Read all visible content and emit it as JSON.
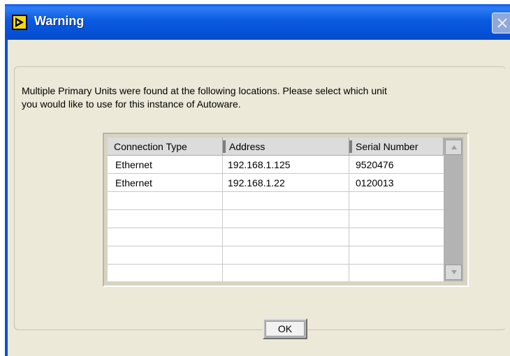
{
  "window": {
    "title": "Warning"
  },
  "message": {
    "line1": "Multiple Primary Units were found at the following locations.  Please select which unit",
    "line2": "you would like to use for this instance of Autoware."
  },
  "table": {
    "columns": [
      "Connection Type",
      "Address",
      "Serial Number"
    ],
    "rows": [
      [
        "Ethernet",
        "192.168.1.125",
        "9520476"
      ],
      [
        "Ethernet",
        "192.168.1.22",
        "0120013"
      ]
    ],
    "empty_rows": 5
  },
  "buttons": {
    "ok": "OK"
  },
  "icons": {
    "app": "labview-vi-icon",
    "close": "close-icon",
    "scroll_up": "scroll-up-arrow-icon",
    "scroll_down": "scroll-down-arrow-icon"
  },
  "colors": {
    "titlebar": "#0A5BEA",
    "dialog_bg": "#ECE9D8",
    "header_bg": "#DCDCDC"
  }
}
